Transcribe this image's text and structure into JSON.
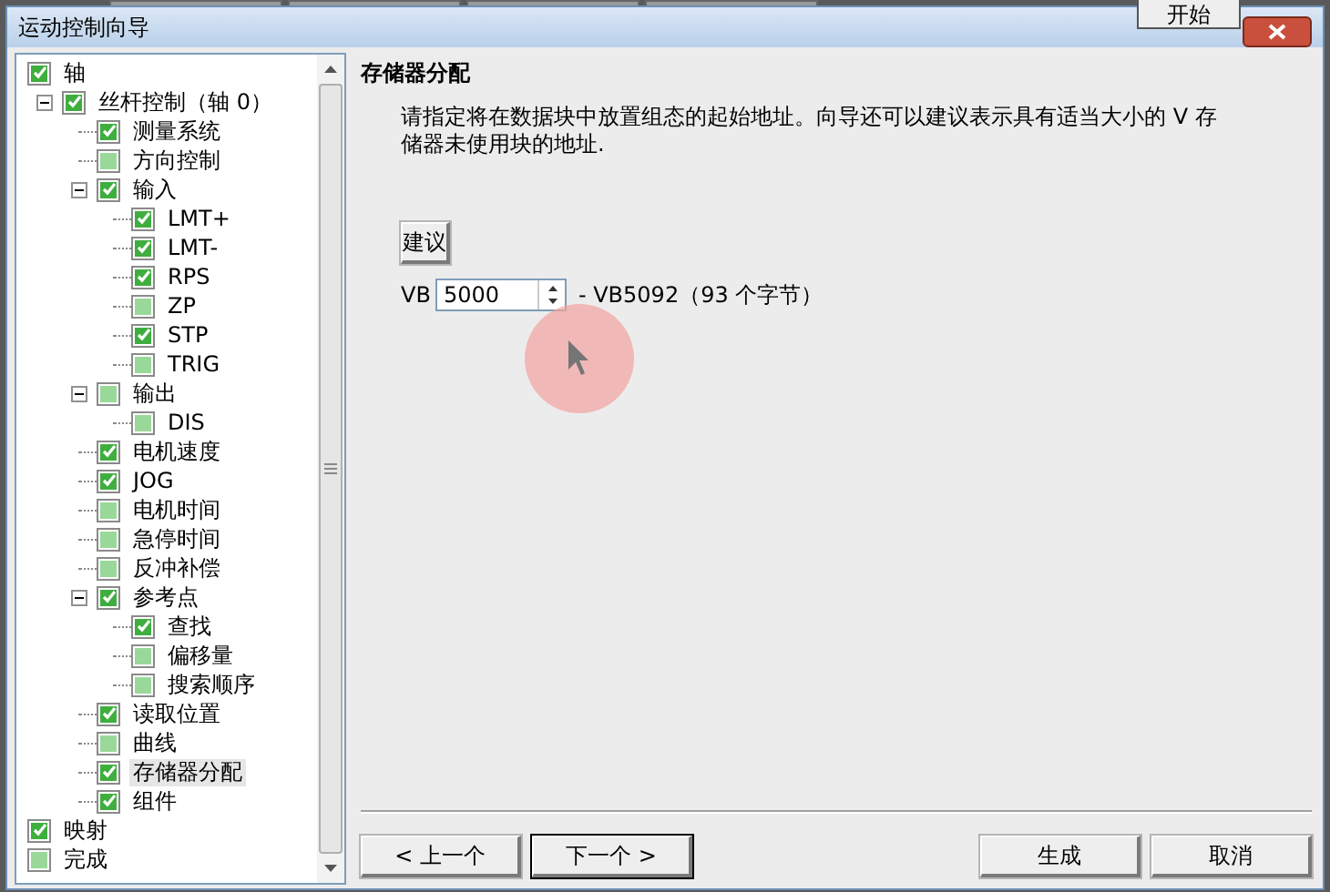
{
  "background": {
    "start_button": "开始"
  },
  "window": {
    "title": "运动控制向导"
  },
  "tree": [
    {
      "label": "轴",
      "checked": true,
      "selected": false,
      "children": [
        {
          "label": "丝杆控制（轴 0）",
          "checked": true,
          "selected": false,
          "expanded": true,
          "children": [
            {
              "label": "测量系统",
              "checked": true,
              "selected": false
            },
            {
              "label": "方向控制",
              "checked": false,
              "selected": false
            },
            {
              "label": "输入",
              "checked": true,
              "selected": false,
              "expanded": true,
              "children": [
                {
                  "label": "LMT+",
                  "checked": true,
                  "selected": false
                },
                {
                  "label": "LMT-",
                  "checked": true,
                  "selected": false
                },
                {
                  "label": "RPS",
                  "checked": true,
                  "selected": false
                },
                {
                  "label": "ZP",
                  "checked": false,
                  "selected": false
                },
                {
                  "label": "STP",
                  "checked": true,
                  "selected": false
                },
                {
                  "label": "TRIG",
                  "checked": false,
                  "selected": false
                }
              ]
            },
            {
              "label": "输出",
              "checked": false,
              "selected": false,
              "expanded": true,
              "children": [
                {
                  "label": "DIS",
                  "checked": false,
                  "selected": false
                }
              ]
            },
            {
              "label": "电机速度",
              "checked": true,
              "selected": false
            },
            {
              "label": "JOG",
              "checked": true,
              "selected": false
            },
            {
              "label": "电机时间",
              "checked": false,
              "selected": false
            },
            {
              "label": "急停时间",
              "checked": false,
              "selected": false
            },
            {
              "label": "反冲补偿",
              "checked": false,
              "selected": false
            },
            {
              "label": "参考点",
              "checked": true,
              "selected": false,
              "expanded": true,
              "children": [
                {
                  "label": "查找",
                  "checked": true,
                  "selected": false
                },
                {
                  "label": "偏移量",
                  "checked": false,
                  "selected": false
                },
                {
                  "label": "搜索顺序",
                  "checked": false,
                  "selected": false
                }
              ]
            },
            {
              "label": "读取位置",
              "checked": true,
              "selected": false
            },
            {
              "label": "曲线",
              "checked": false,
              "selected": false
            },
            {
              "label": "存储器分配",
              "checked": true,
              "selected": true
            },
            {
              "label": "组件",
              "checked": true,
              "selected": false
            }
          ]
        }
      ]
    },
    {
      "label": "映射",
      "checked": true,
      "selected": false
    },
    {
      "label": "完成",
      "checked": false,
      "selected": false
    }
  ],
  "page": {
    "heading": "存储器分配",
    "description": "请指定将在数据块中放置组态的起始地址。向导还可以建议表示具有适当大小的 V 存储器未使用块的地址.",
    "suggest_button": "建议",
    "address_prefix": "VB",
    "address_value": "5000",
    "address_range": "- VB5092（93 个字节）"
  },
  "buttons": [
    "< 上一个",
    "下一个 >",
    "生成",
    "取消"
  ]
}
